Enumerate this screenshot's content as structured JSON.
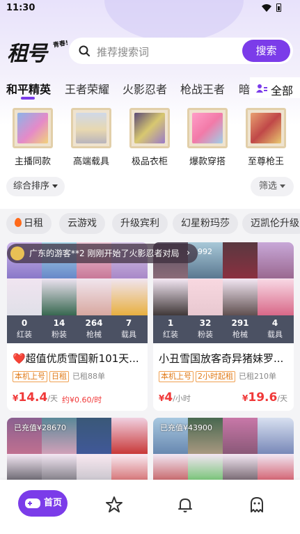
{
  "status_bar": {
    "time": "11:30"
  },
  "header": {
    "logo": "租号",
    "logo_sub": "青春!",
    "search_placeholder": "推荐搜索词",
    "search_button": "搜索"
  },
  "tabs": [
    "和平精英",
    "王者荣耀",
    "火影忍者",
    "枪战王者",
    "暗区"
  ],
  "all_label": "全部",
  "categories": [
    {
      "label": "主播同款",
      "icon": "character-icon"
    },
    {
      "label": "高端载具",
      "icon": "car-icon"
    },
    {
      "label": "极品衣柜",
      "icon": "outfit-icon"
    },
    {
      "label": "爆款穿搭",
      "icon": "outfit-icon"
    },
    {
      "label": "至尊枪王",
      "icon": "character-icon"
    }
  ],
  "sort_label": "综合排序",
  "filter_label": "筛选",
  "tags": [
    "日租",
    "云游戏",
    "升级宾利",
    "幻星粉玛莎",
    "迈凯伦升级"
  ],
  "notice": {
    "text": "广东的游客**2 刚刚开始了火影忍者对局",
    "suffix": "992"
  },
  "listings": [
    {
      "stats": [
        {
          "num": "0",
          "lbl": "红装"
        },
        {
          "num": "14",
          "lbl": "粉装"
        },
        {
          "num": "264",
          "lbl": "枪械"
        },
        {
          "num": "7",
          "lbl": "载具"
        }
      ],
      "title": "❤️超值优质雪国新101天...",
      "badges": [
        "本机上号",
        "日租"
      ],
      "rented": "已租88单",
      "price_main": "14.4",
      "price_main_unit": "/天",
      "price_sub": "约¥0.60/时"
    },
    {
      "stats": [
        {
          "num": "1",
          "lbl": "红装"
        },
        {
          "num": "32",
          "lbl": "粉装"
        },
        {
          "num": "291",
          "lbl": "枪械"
        },
        {
          "num": "4",
          "lbl": "载具"
        }
      ],
      "title": "小丑雪国放客奇异猪妹罗...",
      "badges": [
        "本机上号",
        "2小时起租"
      ],
      "rented": "已租210单",
      "price_main": "4",
      "price_main_unit": "/小时",
      "price_right": "19.6",
      "price_right_unit": "/天"
    },
    {
      "recharge": "已充值¥28670"
    },
    {
      "recharge": "已充值¥43900"
    }
  ],
  "currency": "¥",
  "bottom_nav": {
    "home": "首页"
  },
  "colors": {
    "accent": "#7b3ce9",
    "price": "#f03838",
    "stats_bg": "#4b5163"
  }
}
